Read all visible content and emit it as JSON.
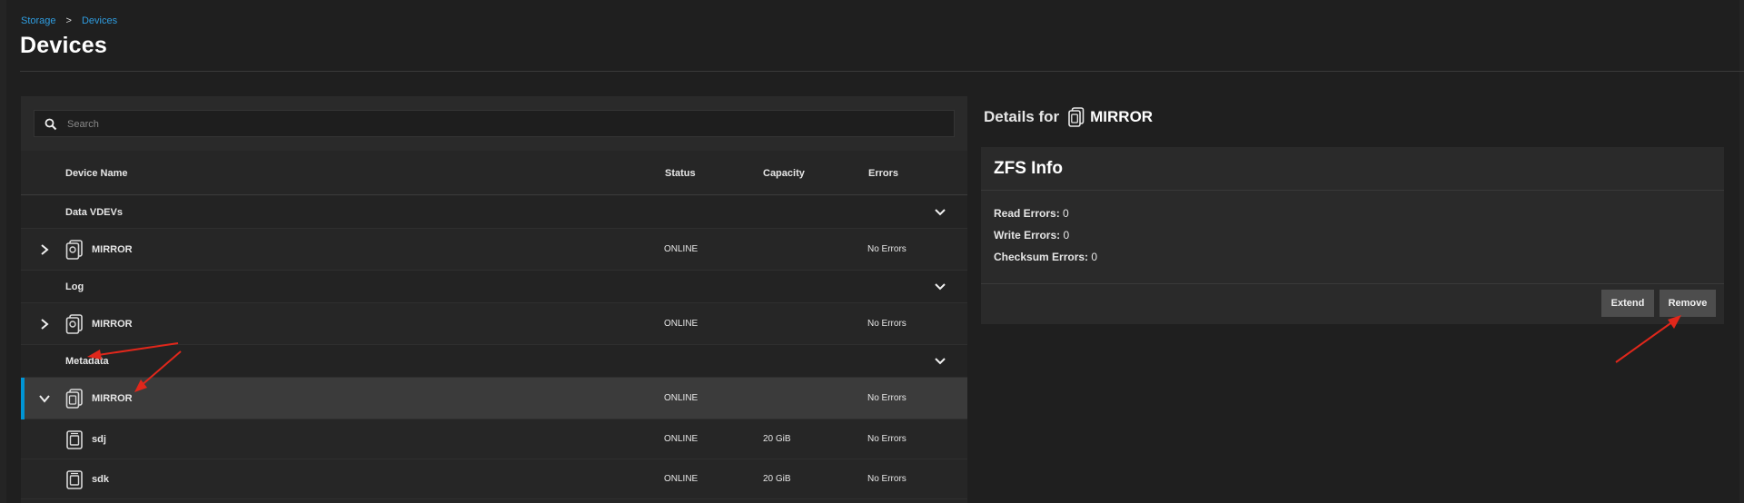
{
  "breadcrumb": {
    "parent": "Storage",
    "separator": ">",
    "current": "Devices"
  },
  "page_title": "Devices",
  "search": {
    "placeholder": "Search",
    "value": ""
  },
  "table": {
    "columns": {
      "name": "Device Name",
      "status": "Status",
      "capacity": "Capacity",
      "errors": "Errors"
    },
    "groups": [
      {
        "label": "Data VDEVs",
        "device": {
          "name": "MIRROR",
          "status": "ONLINE",
          "capacity": "",
          "errors": "No Errors"
        }
      },
      {
        "label": "Log",
        "device": {
          "name": "MIRROR",
          "status": "ONLINE",
          "capacity": "",
          "errors": "No Errors"
        }
      },
      {
        "label": "Metadata",
        "device": {
          "name": "MIRROR",
          "status": "ONLINE",
          "capacity": "",
          "errors": "No Errors"
        },
        "children": [
          {
            "name": "sdj",
            "status": "ONLINE",
            "capacity": "20 GiB",
            "errors": "No Errors"
          },
          {
            "name": "sdk",
            "status": "ONLINE",
            "capacity": "20 GiB",
            "errors": "No Errors"
          }
        ]
      }
    ]
  },
  "details": {
    "title_prefix": "Details for",
    "title_name": "MIRROR",
    "zfs_info": {
      "heading": "ZFS Info",
      "read_errors_label": "Read Errors:",
      "read_errors": "0",
      "write_errors_label": "Write Errors:",
      "write_errors": "0",
      "checksum_errors_label": "Checksum Errors:",
      "checksum_errors": "0"
    },
    "actions": {
      "extend": "Extend",
      "remove": "Remove"
    }
  },
  "colors": {
    "accent": "#0095d5",
    "link": "#2f9de0",
    "annotation": "#e0271b"
  }
}
